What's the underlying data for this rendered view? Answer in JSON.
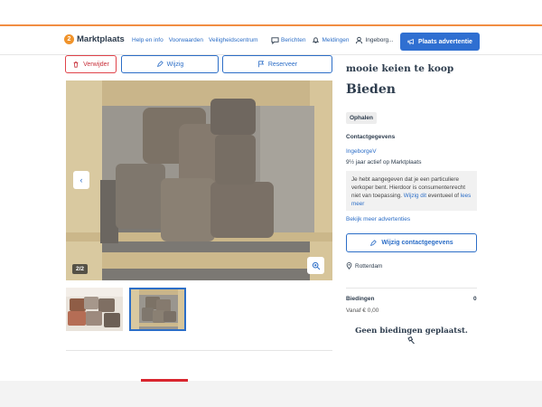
{
  "header": {
    "logo_badge": "2",
    "logo_text": "Marktplaats",
    "nav": [
      "Help en info",
      "Voorwaarden",
      "Veiligheidscentrum"
    ],
    "messages": "Berichten",
    "notifications": "Meldingen",
    "user": "Ingeborg...",
    "place_ad": "Plaats advertentie"
  },
  "actions": {
    "delete": "Verwijder",
    "edit": "Wijzig",
    "reserve": "Reserveer"
  },
  "gallery": {
    "counter": "2/2",
    "prev_icon": "chevron-left-icon",
    "zoom_icon": "zoom-in-icon"
  },
  "listing": {
    "title": "mooie keien te koop",
    "price": "Bieden",
    "delivery": "Ophalen",
    "contact_heading": "Contactgegevens",
    "seller_name": "IngeborgeV",
    "seller_active": "9½ jaar actief op Marktplaats",
    "notice_text": "Je hebt aangegeven dat je een particuliere verkoper bent. Hierdoor is consumentenrecht niet van toepassing.",
    "notice_link": "Wijzig dit",
    "notice_after": "eventueel of",
    "notice_more": "lees meer",
    "more_ads": "Bekijk meer advertenties",
    "edit_contact": "Wijzig contactgegevens",
    "location": "Rotterdam"
  },
  "bids": {
    "heading": "Biedingen",
    "count": "0",
    "from": "Vanaf € 0,00",
    "empty": "Geen biedingen geplaatst."
  },
  "colors": {
    "brand_blue": "#2f6fd1",
    "link_blue": "#2c6ec7",
    "accent_orange": "#f18d42",
    "delete_red": "#e0434a"
  }
}
